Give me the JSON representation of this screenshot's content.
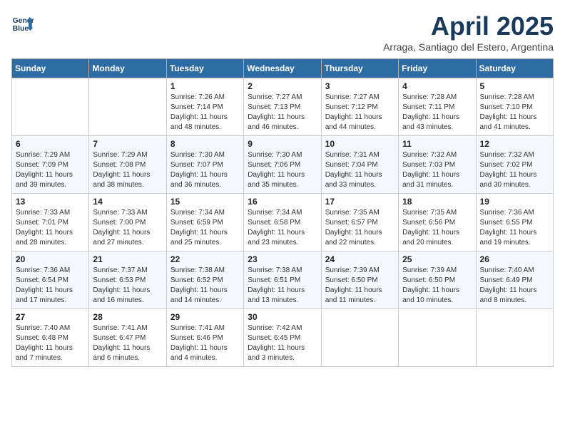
{
  "header": {
    "logo_line1": "General",
    "logo_line2": "Blue",
    "month": "April 2025",
    "location": "Arraga, Santiago del Estero, Argentina"
  },
  "days_of_week": [
    "Sunday",
    "Monday",
    "Tuesday",
    "Wednesday",
    "Thursday",
    "Friday",
    "Saturday"
  ],
  "weeks": [
    [
      {
        "day": "",
        "sunrise": "",
        "sunset": "",
        "daylight": ""
      },
      {
        "day": "",
        "sunrise": "",
        "sunset": "",
        "daylight": ""
      },
      {
        "day": "1",
        "sunrise": "Sunrise: 7:26 AM",
        "sunset": "Sunset: 7:14 PM",
        "daylight": "Daylight: 11 hours and 48 minutes."
      },
      {
        "day": "2",
        "sunrise": "Sunrise: 7:27 AM",
        "sunset": "Sunset: 7:13 PM",
        "daylight": "Daylight: 11 hours and 46 minutes."
      },
      {
        "day": "3",
        "sunrise": "Sunrise: 7:27 AM",
        "sunset": "Sunset: 7:12 PM",
        "daylight": "Daylight: 11 hours and 44 minutes."
      },
      {
        "day": "4",
        "sunrise": "Sunrise: 7:28 AM",
        "sunset": "Sunset: 7:11 PM",
        "daylight": "Daylight: 11 hours and 43 minutes."
      },
      {
        "day": "5",
        "sunrise": "Sunrise: 7:28 AM",
        "sunset": "Sunset: 7:10 PM",
        "daylight": "Daylight: 11 hours and 41 minutes."
      }
    ],
    [
      {
        "day": "6",
        "sunrise": "Sunrise: 7:29 AM",
        "sunset": "Sunset: 7:09 PM",
        "daylight": "Daylight: 11 hours and 39 minutes."
      },
      {
        "day": "7",
        "sunrise": "Sunrise: 7:29 AM",
        "sunset": "Sunset: 7:08 PM",
        "daylight": "Daylight: 11 hours and 38 minutes."
      },
      {
        "day": "8",
        "sunrise": "Sunrise: 7:30 AM",
        "sunset": "Sunset: 7:07 PM",
        "daylight": "Daylight: 11 hours and 36 minutes."
      },
      {
        "day": "9",
        "sunrise": "Sunrise: 7:30 AM",
        "sunset": "Sunset: 7:06 PM",
        "daylight": "Daylight: 11 hours and 35 minutes."
      },
      {
        "day": "10",
        "sunrise": "Sunrise: 7:31 AM",
        "sunset": "Sunset: 7:04 PM",
        "daylight": "Daylight: 11 hours and 33 minutes."
      },
      {
        "day": "11",
        "sunrise": "Sunrise: 7:32 AM",
        "sunset": "Sunset: 7:03 PM",
        "daylight": "Daylight: 11 hours and 31 minutes."
      },
      {
        "day": "12",
        "sunrise": "Sunrise: 7:32 AM",
        "sunset": "Sunset: 7:02 PM",
        "daylight": "Daylight: 11 hours and 30 minutes."
      }
    ],
    [
      {
        "day": "13",
        "sunrise": "Sunrise: 7:33 AM",
        "sunset": "Sunset: 7:01 PM",
        "daylight": "Daylight: 11 hours and 28 minutes."
      },
      {
        "day": "14",
        "sunrise": "Sunrise: 7:33 AM",
        "sunset": "Sunset: 7:00 PM",
        "daylight": "Daylight: 11 hours and 27 minutes."
      },
      {
        "day": "15",
        "sunrise": "Sunrise: 7:34 AM",
        "sunset": "Sunset: 6:59 PM",
        "daylight": "Daylight: 11 hours and 25 minutes."
      },
      {
        "day": "16",
        "sunrise": "Sunrise: 7:34 AM",
        "sunset": "Sunset: 6:58 PM",
        "daylight": "Daylight: 11 hours and 23 minutes."
      },
      {
        "day": "17",
        "sunrise": "Sunrise: 7:35 AM",
        "sunset": "Sunset: 6:57 PM",
        "daylight": "Daylight: 11 hours and 22 minutes."
      },
      {
        "day": "18",
        "sunrise": "Sunrise: 7:35 AM",
        "sunset": "Sunset: 6:56 PM",
        "daylight": "Daylight: 11 hours and 20 minutes."
      },
      {
        "day": "19",
        "sunrise": "Sunrise: 7:36 AM",
        "sunset": "Sunset: 6:55 PM",
        "daylight": "Daylight: 11 hours and 19 minutes."
      }
    ],
    [
      {
        "day": "20",
        "sunrise": "Sunrise: 7:36 AM",
        "sunset": "Sunset: 6:54 PM",
        "daylight": "Daylight: 11 hours and 17 minutes."
      },
      {
        "day": "21",
        "sunrise": "Sunrise: 7:37 AM",
        "sunset": "Sunset: 6:53 PM",
        "daylight": "Daylight: 11 hours and 16 minutes."
      },
      {
        "day": "22",
        "sunrise": "Sunrise: 7:38 AM",
        "sunset": "Sunset: 6:52 PM",
        "daylight": "Daylight: 11 hours and 14 minutes."
      },
      {
        "day": "23",
        "sunrise": "Sunrise: 7:38 AM",
        "sunset": "Sunset: 6:51 PM",
        "daylight": "Daylight: 11 hours and 13 minutes."
      },
      {
        "day": "24",
        "sunrise": "Sunrise: 7:39 AM",
        "sunset": "Sunset: 6:50 PM",
        "daylight": "Daylight: 11 hours and 11 minutes."
      },
      {
        "day": "25",
        "sunrise": "Sunrise: 7:39 AM",
        "sunset": "Sunset: 6:50 PM",
        "daylight": "Daylight: 11 hours and 10 minutes."
      },
      {
        "day": "26",
        "sunrise": "Sunrise: 7:40 AM",
        "sunset": "Sunset: 6:49 PM",
        "daylight": "Daylight: 11 hours and 8 minutes."
      }
    ],
    [
      {
        "day": "27",
        "sunrise": "Sunrise: 7:40 AM",
        "sunset": "Sunset: 6:48 PM",
        "daylight": "Daylight: 11 hours and 7 minutes."
      },
      {
        "day": "28",
        "sunrise": "Sunrise: 7:41 AM",
        "sunset": "Sunset: 6:47 PM",
        "daylight": "Daylight: 11 hours and 6 minutes."
      },
      {
        "day": "29",
        "sunrise": "Sunrise: 7:41 AM",
        "sunset": "Sunset: 6:46 PM",
        "daylight": "Daylight: 11 hours and 4 minutes."
      },
      {
        "day": "30",
        "sunrise": "Sunrise: 7:42 AM",
        "sunset": "Sunset: 6:45 PM",
        "daylight": "Daylight: 11 hours and 3 minutes."
      },
      {
        "day": "",
        "sunrise": "",
        "sunset": "",
        "daylight": ""
      },
      {
        "day": "",
        "sunrise": "",
        "sunset": "",
        "daylight": ""
      },
      {
        "day": "",
        "sunrise": "",
        "sunset": "",
        "daylight": ""
      }
    ]
  ]
}
